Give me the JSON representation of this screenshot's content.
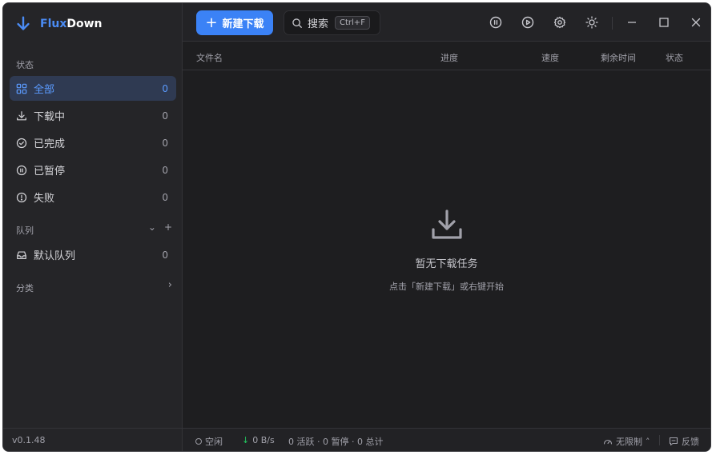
{
  "app": {
    "name_part1": "Flux",
    "name_part2": "Down",
    "version": "v0.1.48"
  },
  "sidebar": {
    "status_label": "状态",
    "items": [
      {
        "label": "全部",
        "count": "0",
        "icon": "grid-icon"
      },
      {
        "label": "下载中",
        "count": "0",
        "icon": "download-icon"
      },
      {
        "label": "已完成",
        "count": "0",
        "icon": "check-circle-icon"
      },
      {
        "label": "已暂停",
        "count": "0",
        "icon": "pause-circle-icon"
      },
      {
        "label": "失败",
        "count": "0",
        "icon": "alert-circle-icon"
      }
    ],
    "queue_label": "队列",
    "queue_items": [
      {
        "label": "默认队列",
        "count": "0",
        "icon": "inbox-icon"
      }
    ],
    "category_label": "分类"
  },
  "toolbar": {
    "new_download_label": "新建下载",
    "search_placeholder": "搜索",
    "search_shortcut": "Ctrl+F"
  },
  "table": {
    "columns": [
      "文件名",
      "进度",
      "速度",
      "剩余时间",
      "状态"
    ]
  },
  "empty_state": {
    "title": "暂无下载任务",
    "subtitle": "点击「新建下载」或右键开始"
  },
  "statusbar": {
    "state": "空闲",
    "speed": "0 B/s",
    "summary": "0 活跃 · 0 暂停 · 0 总计",
    "limit": "无限制",
    "feedback": "反馈"
  },
  "colors": {
    "accent": "#3b82f6",
    "active_bg": "#2f3a52",
    "download_arrow": "#22c55e"
  }
}
